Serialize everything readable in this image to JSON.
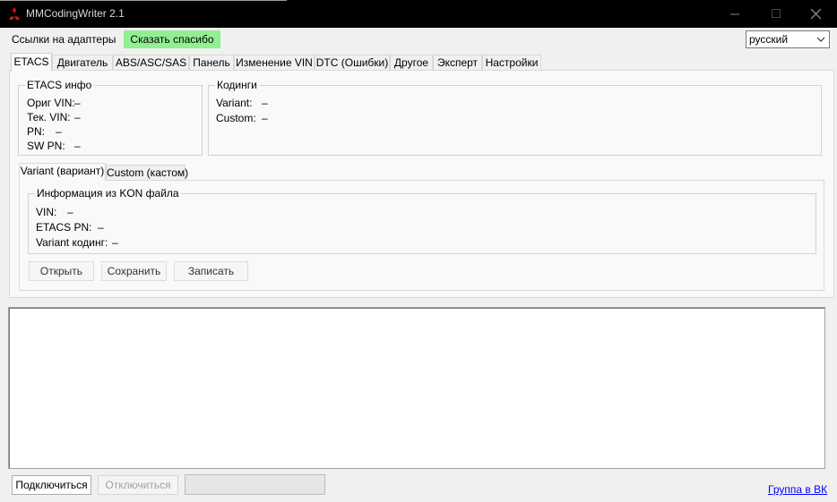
{
  "window": {
    "title": "MMCodingWriter 2.1"
  },
  "menu": {
    "links": "Ссылки на адаптеры",
    "thanks": "Сказать спасибо"
  },
  "language": {
    "selected": "русский"
  },
  "tabs": [
    {
      "label": "ETACS",
      "active": true
    },
    {
      "label": "Двигатель"
    },
    {
      "label": "ABS/ASC/SAS"
    },
    {
      "label": "Панель"
    },
    {
      "label": "Изменение VIN"
    },
    {
      "label": "DTC (Ошибки)"
    },
    {
      "label": "Другое"
    },
    {
      "label": "Эксперт"
    },
    {
      "label": "Настройки"
    }
  ],
  "etacs_info": {
    "title": "ETACS инфо",
    "orig_vin_label": "Ориг VIN:",
    "orig_vin_value": "–",
    "cur_vin_label": "Тек. VIN:",
    "cur_vin_value": "–",
    "pn_label": "PN:",
    "pn_value": "–",
    "sw_pn_label": "SW PN:",
    "sw_pn_value": "–"
  },
  "codings": {
    "title": "Кодинги",
    "variant_label": "Variant:",
    "variant_value": "–",
    "custom_label": "Custom:",
    "custom_value": "–"
  },
  "subtabs": [
    {
      "label": "Variant (вариант)",
      "active": true
    },
    {
      "label": "Custom (кастом)"
    }
  ],
  "kon_info": {
    "title": "Информация из KON файла",
    "vin_label": "VIN:",
    "vin_value": "–",
    "etacs_pn_label": "ETACS PN:",
    "etacs_pn_value": "–",
    "variant_coding_label": "Variant кодинг:",
    "variant_coding_value": "–"
  },
  "actions": {
    "open": "Открыть",
    "save": "Сохранить",
    "write": "Записать"
  },
  "footer": {
    "connect": "Подключиться",
    "disconnect": "Отключиться",
    "progress": 0,
    "vk_link": "Группа в ВК"
  },
  "colors": {
    "thanks_bg": "#92ef92",
    "titlebar_bg": "#000000",
    "link": "#0000ff"
  }
}
